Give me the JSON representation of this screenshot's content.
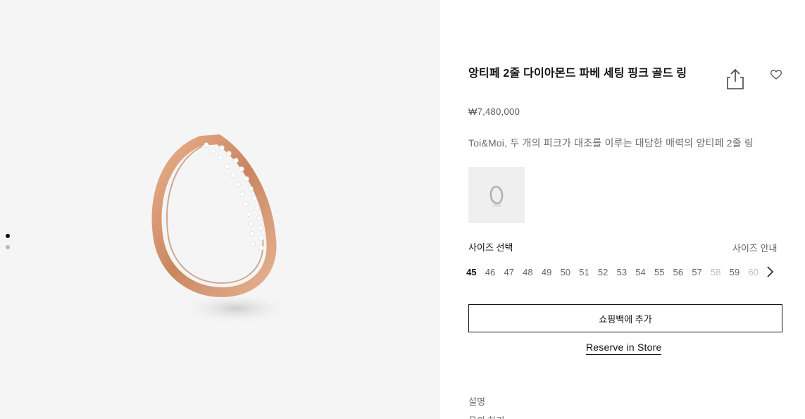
{
  "product": {
    "title": "앙티페 2줄 다이아몬드 파베 세팅 핑크 골드 링",
    "price": "₩7,480,000",
    "description": "Toi&Moi, 두 개의 피크가 대조를 이루는 대담한 매력의 앙티페 2줄 링"
  },
  "gallery": {
    "main_image": "pink-gold-diamond-ring",
    "dots": [
      {
        "state": "active"
      },
      {
        "state": "inactive"
      }
    ]
  },
  "actions": {
    "share_icon": "share-icon",
    "wishlist_icon": "heart-icon",
    "add_to_bag_label": "쇼핑백에 추가",
    "reserve_label": "Reserve in Store"
  },
  "variants": [
    {
      "image": "white-gold-ring-thumbnail"
    }
  ],
  "size": {
    "label": "사이즈 선택",
    "guide_label": "사이즈 안내",
    "selected": "45",
    "options": [
      {
        "value": "45",
        "state": "selected"
      },
      {
        "value": "46",
        "state": "available"
      },
      {
        "value": "47",
        "state": "available"
      },
      {
        "value": "48",
        "state": "available"
      },
      {
        "value": "49",
        "state": "available"
      },
      {
        "value": "50",
        "state": "available"
      },
      {
        "value": "51",
        "state": "available"
      },
      {
        "value": "52",
        "state": "available"
      },
      {
        "value": "53",
        "state": "available"
      },
      {
        "value": "54",
        "state": "available"
      },
      {
        "value": "55",
        "state": "available"
      },
      {
        "value": "56",
        "state": "available"
      },
      {
        "value": "57",
        "state": "available"
      },
      {
        "value": "58",
        "state": "disabled"
      },
      {
        "value": "59",
        "state": "available"
      },
      {
        "value": "60",
        "state": "disabled"
      }
    ],
    "next_icon": "chevron-right-icon"
  },
  "accordion": [
    {
      "label": "설명"
    },
    {
      "label": "문의 하기"
    }
  ],
  "colors": {
    "gallery_bg": "#f5f5f5",
    "rose_gold": "#d4926a",
    "text_primary": "#111111",
    "text_secondary": "#6b6b6b"
  }
}
